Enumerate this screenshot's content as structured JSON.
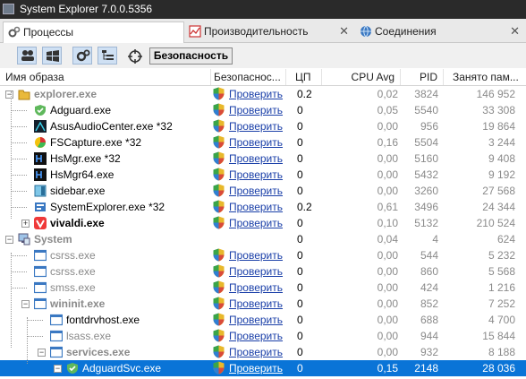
{
  "window": {
    "title": "System Explorer 7.0.0.5356"
  },
  "tabs": [
    {
      "label": "Процессы",
      "icon": "gears-icon",
      "active": true
    },
    {
      "label": "Производительность",
      "icon": "performance-icon",
      "close": "✕"
    },
    {
      "label": "Соединения",
      "icon": "globe-icon",
      "close": "✕"
    }
  ],
  "toolbar": {
    "security_label": "Безопасность"
  },
  "columns": {
    "name": "Имя образа",
    "security": "Безопаснос...",
    "cpu": "ЦП",
    "cpu_avg": "CPU Avg",
    "pid": "PID",
    "mem": "Занято пам..."
  },
  "rows": [
    {
      "name": "explorer.exe",
      "cpu": "0.2",
      "avg": "0,02",
      "pid": "3824",
      "mem": "146 952",
      "link": "Проверить",
      "style": "gray-bold",
      "icon": "folder-icon"
    },
    {
      "name": "Adguard.exe",
      "cpu": "0",
      "avg": "0,05",
      "pid": "5540",
      "mem": "33 308",
      "link": "Проверить",
      "style": "",
      "icon": "adguard-icon"
    },
    {
      "name": "AsusAudioCenter.exe *32",
      "cpu": "0",
      "avg": "0,00",
      "pid": "956",
      "mem": "19 864",
      "link": "Проверить",
      "style": "",
      "icon": "audio-icon"
    },
    {
      "name": "FSCapture.exe *32",
      "cpu": "0",
      "avg": "0,16",
      "pid": "5504",
      "mem": "3 244",
      "link": "Проверить",
      "style": "",
      "icon": "capture-icon"
    },
    {
      "name": "HsMgr.exe *32",
      "cpu": "0",
      "avg": "0,00",
      "pid": "5160",
      "mem": "9 408",
      "link": "Проверить",
      "style": "",
      "icon": "hotkey-icon"
    },
    {
      "name": "HsMgr64.exe",
      "cpu": "0",
      "avg": "0,00",
      "pid": "5432",
      "mem": "9 192",
      "link": "Проверить",
      "style": "",
      "icon": "hotkey-icon"
    },
    {
      "name": "sidebar.exe",
      "cpu": "0",
      "avg": "0,00",
      "pid": "3260",
      "mem": "27 568",
      "link": "Проверить",
      "style": "",
      "icon": "sidebar-icon"
    },
    {
      "name": "SystemExplorer.exe *32",
      "cpu": "0.2",
      "avg": "0,61",
      "pid": "3496",
      "mem": "24 344",
      "link": "Проверить",
      "style": "",
      "icon": "sysexplorer-icon"
    },
    {
      "name": "vivaldi.exe",
      "cpu": "0",
      "avg": "0,10",
      "pid": "5132",
      "mem": "210 524",
      "link": "Проверить",
      "style": "bold",
      "icon": "vivaldi-icon"
    },
    {
      "name": "System",
      "cpu": "0",
      "avg": "0,04",
      "pid": "4",
      "mem": "624",
      "link": "",
      "style": "gray-bold",
      "icon": "system-icon"
    },
    {
      "name": "csrss.exe",
      "cpu": "0",
      "avg": "0,00",
      "pid": "544",
      "mem": "5 232",
      "link": "Проверить",
      "style": "gray",
      "icon": "window-icon"
    },
    {
      "name": "csrss.exe",
      "cpu": "0",
      "avg": "0,00",
      "pid": "860",
      "mem": "5 568",
      "link": "Проверить",
      "style": "gray",
      "icon": "window-icon"
    },
    {
      "name": "smss.exe",
      "cpu": "0",
      "avg": "0,00",
      "pid": "424",
      "mem": "1 216",
      "link": "Проверить",
      "style": "gray",
      "icon": "window-icon"
    },
    {
      "name": "wininit.exe",
      "cpu": "0",
      "avg": "0,00",
      "pid": "852",
      "mem": "7 252",
      "link": "Проверить",
      "style": "gray-bold",
      "icon": "window-icon"
    },
    {
      "name": "fontdrvhost.exe",
      "cpu": "0",
      "avg": "0,00",
      "pid": "688",
      "mem": "4 700",
      "link": "Проверить",
      "style": "",
      "icon": "window-icon"
    },
    {
      "name": "lsass.exe",
      "cpu": "0",
      "avg": "0,00",
      "pid": "944",
      "mem": "15 844",
      "link": "Проверить",
      "style": "gray",
      "icon": "window-icon"
    },
    {
      "name": "services.exe",
      "cpu": "0",
      "avg": "0,00",
      "pid": "932",
      "mem": "8 188",
      "link": "Проверить",
      "style": "gray-bold",
      "icon": "window-icon"
    },
    {
      "name": "AdguardSvc.exe",
      "cpu": "0",
      "avg": "0,15",
      "pid": "2148",
      "mem": "28 036",
      "link": "Проверить",
      "style": "selected",
      "icon": "adguard-icon"
    }
  ]
}
